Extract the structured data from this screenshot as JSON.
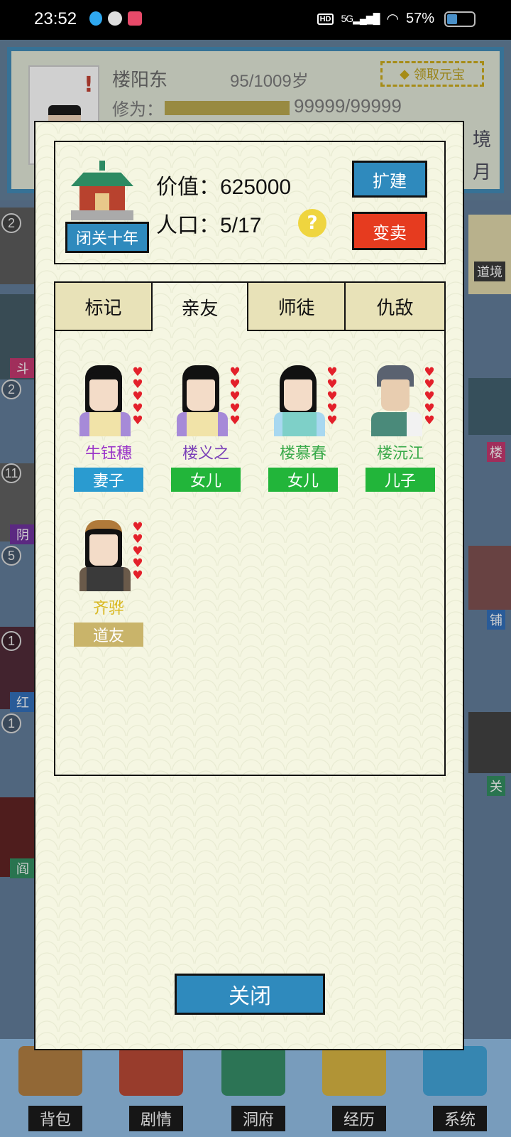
{
  "status_bar": {
    "time": "23:52",
    "network": "5G",
    "battery": "57%"
  },
  "background": {
    "name": "楼阳东",
    "age": "95/1009岁",
    "reward_label": "领取元宝",
    "cultivation_label": "修为：",
    "cultivation_value": "99999/99999",
    "side_texts": [
      "境",
      "月"
    ],
    "row_numbers": [
      "2",
      "2",
      "11",
      "5",
      "1",
      "1"
    ],
    "left_tags": [
      "斗",
      "阴",
      "红",
      "阎"
    ],
    "right_tags": [
      "道境",
      "楼",
      "铺",
      "关"
    ],
    "bottom_nav": [
      "背包",
      "剧情",
      "洞府",
      "经历",
      "系统"
    ]
  },
  "modal": {
    "seclude_button": "闭关十年",
    "value_label": "价值：",
    "value": "625000",
    "population_label": "人口：",
    "population": "5/17",
    "help_glyph": "?",
    "expand_button": "扩建",
    "sell_button": "变卖",
    "tabs": [
      {
        "label": "标记",
        "active": false
      },
      {
        "label": "亲友",
        "active": true
      },
      {
        "label": "师徒",
        "active": false
      },
      {
        "label": "仇敌",
        "active": false
      }
    ],
    "members": [
      {
        "name": "牛钰穗",
        "relation": "妻子",
        "name_color": "#9b36c9",
        "relation_color": "#2a9bd0",
        "hearts": 5
      },
      {
        "name": "楼义之",
        "relation": "女儿",
        "name_color": "#7a3fb8",
        "relation_color": "#22b53a",
        "hearts": 5
      },
      {
        "name": "楼慕春",
        "relation": "女儿",
        "name_color": "#3aaa4a",
        "relation_color": "#22b53a",
        "hearts": 5
      },
      {
        "name": "楼沅江",
        "relation": "儿子",
        "name_color": "#3aaa4a",
        "relation_color": "#22b53a",
        "hearts": 5
      },
      {
        "name": "齐骅",
        "relation": "道友",
        "name_color": "#d9b820",
        "relation_color": "#c9b46a",
        "hearts": 5
      }
    ],
    "close_button": "关闭"
  }
}
